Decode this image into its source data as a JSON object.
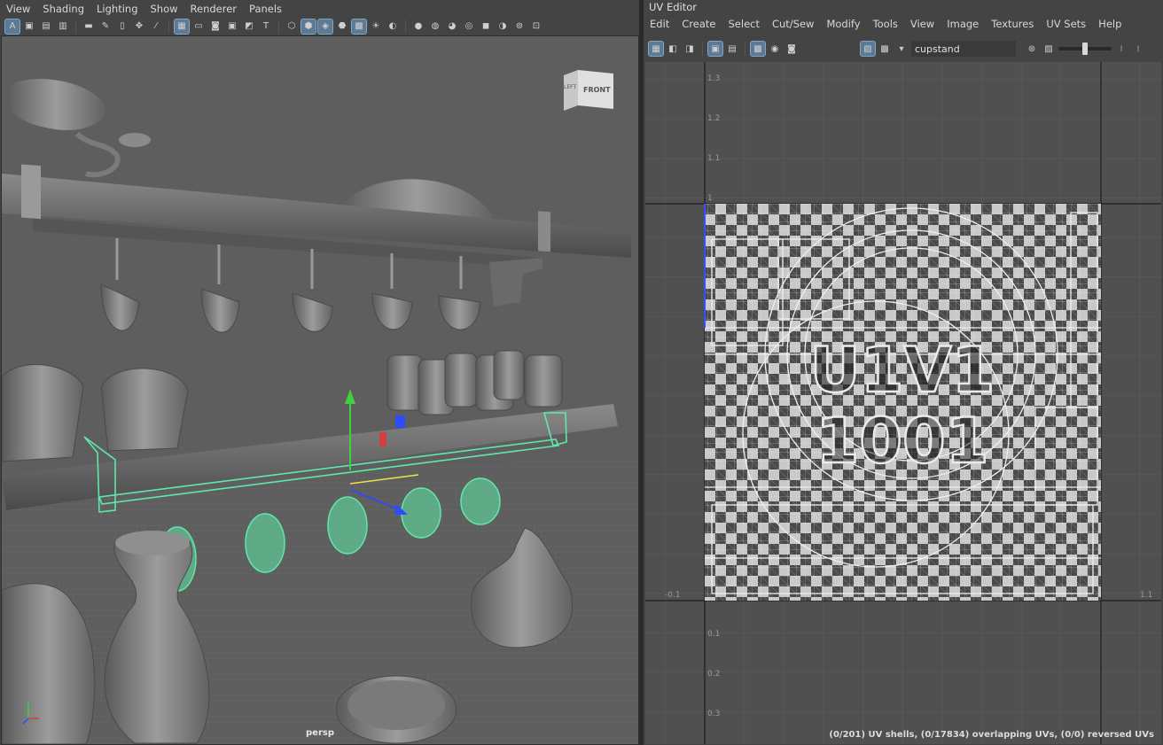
{
  "viewport": {
    "menu": [
      "View",
      "Shading",
      "Lighting",
      "Show",
      "Renderer",
      "Panels"
    ],
    "camera_label": "persp",
    "viewcube_front": "FRONT",
    "viewcube_left": "LEFT",
    "icons": [
      "select-camera-icon",
      "camera-attributes-icon",
      "bookmark-icon",
      "image-plane-icon",
      "2d-pan-icon",
      "grease-pencil-icon",
      "grid-icon",
      "film-gate-icon",
      "resolution-gate-icon",
      "gate-mask-icon",
      "field-chart-icon",
      "safe-action-icon",
      "safe-title-icon",
      "wireframe-icon",
      "smooth-shade-icon",
      "wireframe-on-shaded-icon",
      "textured-icon",
      "use-all-lights-icon",
      "shadows-icon",
      "ambient-occlusion-icon",
      "motion-blur-icon",
      "isolate-select-icon",
      "xray-icon",
      "xray-joints-icon"
    ]
  },
  "uv_editor": {
    "title": "UV Editor",
    "menu": [
      "Edit",
      "Create",
      "Select",
      "Cut/Sew",
      "Modify",
      "Tools",
      "View",
      "Image",
      "Textures",
      "UV Sets",
      "Help"
    ],
    "uv_set_field": "cupstand",
    "udim_label": "U1V1",
    "tile_number": "1001",
    "v_labels": [
      "1.3",
      "1.2",
      "1.1",
      "1",
      "0.1",
      "0.2",
      "0.3"
    ],
    "u_labels": [
      "-0.1",
      "1.1"
    ],
    "status": "(0/201) UV shells, (0/17834) overlapping UVs, (0/0) reversed UVs",
    "image_display_slider": 0.5
  },
  "colors": {
    "selection": "#5fe8a8",
    "background": "#444444",
    "grid": "#6a6a6a"
  }
}
